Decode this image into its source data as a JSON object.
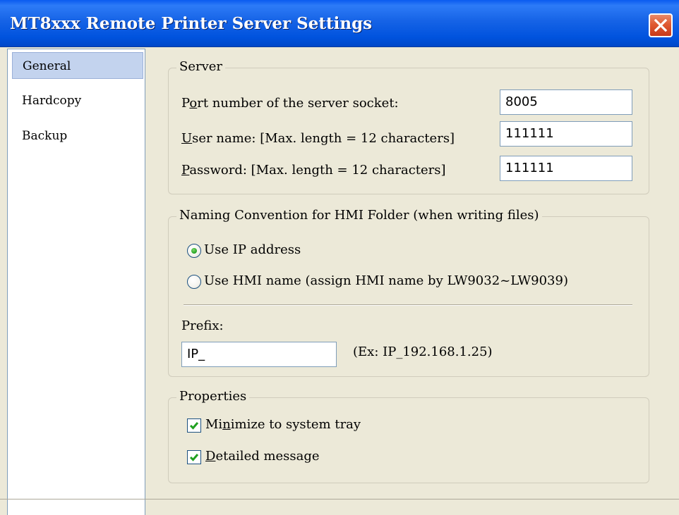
{
  "window": {
    "title": "MT8xxx Remote Printer Server Settings"
  },
  "sidebar": {
    "items": [
      {
        "label": "General",
        "selected": true
      },
      {
        "label": "Hardcopy",
        "selected": false
      },
      {
        "label": "Backup",
        "selected": false
      }
    ]
  },
  "server": {
    "legend": "Server",
    "port_label_pre": "P",
    "port_label_u": "o",
    "port_label_post": "rt number of the server socket:",
    "port_value": "8005",
    "user_label_u": "U",
    "user_label_post": "ser name: [Max. length = 12 characters]",
    "user_value": "111111",
    "password_label_u": "P",
    "password_label_post": "assword: [Max. length = 12 characters]",
    "password_value": "111111"
  },
  "naming": {
    "legend": "Naming Convention for HMI Folder (when writing files)",
    "option_ip": "Use IP address",
    "option_hmi": "Use HMI name (assign HMI name by LW9032~LW9039)",
    "selected": "ip",
    "prefix_label": "Prefix:",
    "prefix_value": "IP_",
    "example": "(Ex: IP_192.168.1.25)"
  },
  "properties": {
    "legend": "Properties",
    "minimize_pre": "Mi",
    "minimize_u": "n",
    "minimize_post": "imize to system tray",
    "minimize_checked": true,
    "detailed_u": "D",
    "detailed_post": "etailed message",
    "detailed_checked": true
  },
  "colors": {
    "titlebar": "#0054e3",
    "close_button": "#e05a32",
    "dialog_bg": "#ece9d8",
    "selection": "#c3d3ee",
    "check_mark": "#21a121"
  }
}
